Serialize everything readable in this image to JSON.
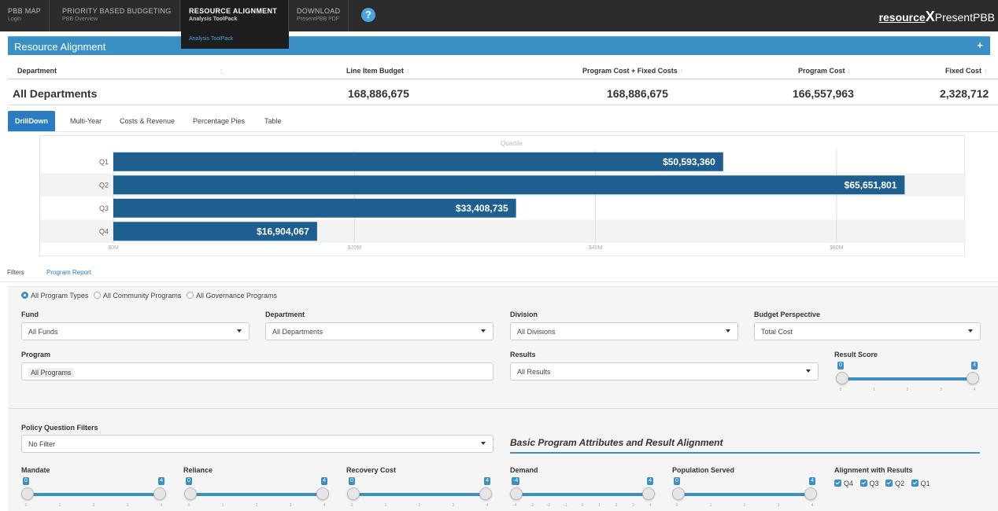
{
  "nav": {
    "items": [
      {
        "title": "PBB MAP",
        "subtitle": "Login"
      },
      {
        "title": "PRIORITY BASED BUDGETING",
        "subtitle": "PBB Overview"
      },
      {
        "title": "RESOURCE ALIGNMENT",
        "subtitle": "Analysis ToolPack"
      },
      {
        "title": "DOWNLOAD",
        "subtitle": "PresentPBB PDF"
      }
    ],
    "help_label": "?",
    "dropdown_item": "Analysis ToolPack",
    "brand_resource": "resource",
    "brand_x": "X",
    "brand_present": "PresentPBB"
  },
  "banner": {
    "title": "Resource Alignment",
    "plus": "+"
  },
  "table": {
    "headers": [
      "Department",
      "Line Item Budget",
      "Program Cost + Fixed Costs",
      "Program Cost",
      "Fixed Cost"
    ],
    "sort_glyph": "↕",
    "row": {
      "department": "All Departments",
      "line_item_budget": "168,886,675",
      "program_plus_fixed": "168,886,675",
      "program_cost": "166,557,963",
      "fixed_cost": "2,328,712"
    }
  },
  "view_tabs": [
    "DrillDown",
    "Multi-Year",
    "Costs & Revenue",
    "Percentage Pies",
    "Table"
  ],
  "chart_data": {
    "type": "bar",
    "orientation": "horizontal",
    "title": "Quartile",
    "categories": [
      "Q1",
      "Q2",
      "Q3",
      "Q4"
    ],
    "values": [
      50593360,
      65651801,
      33408735,
      16904067
    ],
    "value_labels": [
      "$50,593,360",
      "$65,651,801",
      "$33,408,735",
      "$16,904,067"
    ],
    "xlim": [
      0,
      70000000
    ],
    "ticks": [
      0,
      20000000,
      40000000,
      60000000
    ],
    "tick_labels": [
      "$0M",
      "$20M",
      "$40M",
      "$60M"
    ],
    "bar_color": "#1f5f8f",
    "grid": true
  },
  "filter_tabs": [
    "Filters",
    "Program Report"
  ],
  "program_types": {
    "options": [
      "All Program Types",
      "All Community Programs",
      "All Governance Programs"
    ],
    "selected": 0
  },
  "filters": {
    "fund": {
      "label": "Fund",
      "value": "All Funds"
    },
    "department": {
      "label": "Department",
      "value": "All Departments"
    },
    "division": {
      "label": "Division",
      "value": "All Divisions"
    },
    "budget_perspective": {
      "label": "Budget Perspective",
      "value": "Total Cost"
    },
    "program": {
      "label": "Program",
      "value": "All Programs"
    },
    "results": {
      "label": "Results",
      "value": "All Results"
    },
    "result_score": {
      "label": "Result Score",
      "min": 0,
      "max": 4,
      "ticks": [
        "0",
        "1",
        "2",
        "3",
        "4"
      ]
    }
  },
  "policy": {
    "label": "Policy Question Filters",
    "value": "No Filter"
  },
  "attributes": {
    "title": "Basic Program Attributes and Result Alignment",
    "mandate": {
      "label": "Mandate",
      "min": 0,
      "max": 4,
      "ticks": [
        "0",
        "1",
        "2",
        "3",
        "4"
      ]
    },
    "reliance": {
      "label": "Reliance",
      "min": 0,
      "max": 4,
      "ticks": [
        "0",
        "1",
        "2",
        "3",
        "4"
      ]
    },
    "recovery_cost": {
      "label": "Recovery Cost",
      "min": 0,
      "max": 4,
      "ticks": [
        "0",
        "1",
        "2",
        "3",
        "4"
      ]
    },
    "demand": {
      "label": "Demand",
      "min": -4,
      "max": 4,
      "ticks": [
        "-4",
        "-3",
        "-2",
        "-1",
        "0",
        "1",
        "2",
        "3",
        "4"
      ]
    },
    "population_served": {
      "label": "Population Served",
      "min": 0,
      "max": 4,
      "ticks": [
        "0",
        "1",
        "2",
        "3",
        "4"
      ]
    },
    "alignment": {
      "label": "Alignment with Results",
      "options": [
        "Q4",
        "Q3",
        "Q2",
        "Q1"
      ]
    }
  }
}
